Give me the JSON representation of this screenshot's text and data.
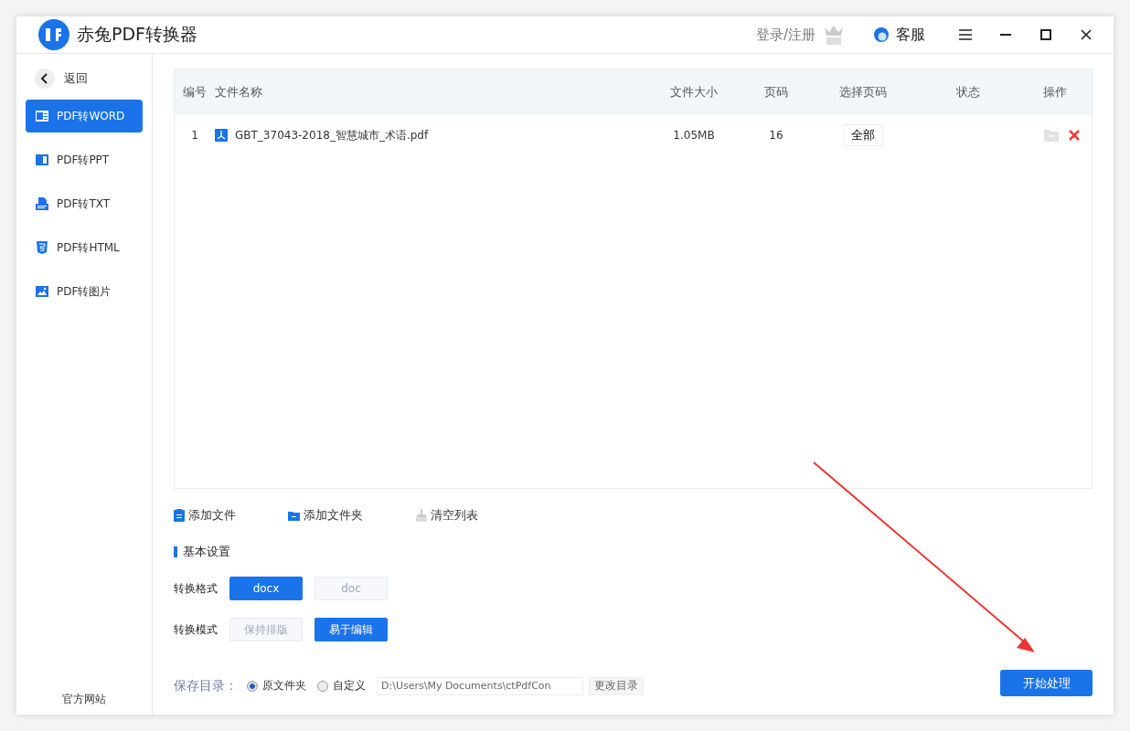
{
  "window": {
    "title": "赤兔PDF转换器",
    "login": "登录/注册",
    "support": "客服"
  },
  "sidebar": {
    "back": "返回",
    "items": [
      {
        "label": "PDF转WORD",
        "kind": "word",
        "selected": true
      },
      {
        "label": "PDF转PPT",
        "kind": "ppt",
        "selected": false
      },
      {
        "label": "PDF转TXT",
        "kind": "txt",
        "selected": false
      },
      {
        "label": "PDF转HTML",
        "kind": "html",
        "selected": false
      },
      {
        "label": "PDF转图片",
        "kind": "image",
        "selected": false
      }
    ],
    "footer": "官方网站"
  },
  "table": {
    "columns": [
      "编号",
      "文件名称",
      "文件大小",
      "页码",
      "选择页码",
      "状态",
      "操作"
    ],
    "rows": [
      {
        "index": "1",
        "name": "GBT_37043-2018_智慧城市_术语.pdf",
        "size": "1.05MB",
        "pages": "16",
        "page_select": "全部"
      }
    ]
  },
  "actions": [
    {
      "label": "添加文件",
      "kind": "file"
    },
    {
      "label": "添加文件夹",
      "kind": "folder"
    },
    {
      "label": "清空列表",
      "kind": "clear"
    }
  ],
  "settings": {
    "title": "基本设置",
    "groups": [
      {
        "label": "转换格式",
        "options": [
          {
            "label": "docx",
            "selected": true
          },
          {
            "label": "doc",
            "selected": false
          }
        ]
      },
      {
        "label": "转换模式",
        "options": [
          {
            "label": "保持排版",
            "selected": false
          },
          {
            "label": "易于编辑",
            "selected": true
          }
        ]
      }
    ]
  },
  "save": {
    "label": "保存目录：",
    "options": [
      {
        "label": "原文件夹",
        "selected": true
      },
      {
        "label": "自定义",
        "selected": false
      }
    ],
    "path": "D:\\Users\\My Documents\\ctPdfCon",
    "change": "更改目录"
  },
  "start": "开始处理"
}
